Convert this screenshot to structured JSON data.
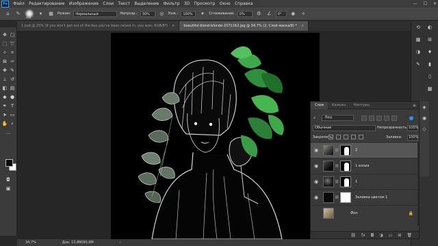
{
  "app": {
    "logo": "Ps"
  },
  "menubar": {
    "items": [
      "Файл",
      "Редактирование",
      "Изображение",
      "Слои",
      "Текст",
      "Выделение",
      "Фильтр",
      "3D",
      "Просмотр",
      "Окно",
      "Справка"
    ],
    "window_controls": {
      "minimize": "—",
      "maximize": "☐",
      "close": "✕"
    }
  },
  "options": {
    "brush_size": "432",
    "mode_label": "Режим:",
    "mode_value": "Нормальный",
    "opacity_label": "Непрозр.:",
    "opacity_value": "30%",
    "flow_label": "Наж.:",
    "flow_value": "100%",
    "smoothing_label": "Сглаживание:",
    "smoothing_value": "0%",
    "angle_value": "0°"
  },
  "tabs": [
    {
      "title": "1.psd @ 25% (If you don't get out of the box you've been raised in, you won, RGB/8*)",
      "close": "×",
      "active": false
    },
    {
      "title": "beautiful-blond-blonde-1071162.jpg @ 34,7% (2, Слой-маска/8) *",
      "close": "×",
      "active": true
    }
  ],
  "statusbar": {
    "zoom": "34,7%",
    "doc_info": "Док: 15,8M/90,9M",
    "arrow": "›"
  },
  "colors": {
    "accent": "#2a90ff",
    "canvas_bg": "#000000",
    "panel_bg": "#3a3a3a",
    "leaf_green": "#3ea84a"
  },
  "layers_panel": {
    "tabs": [
      "Слои",
      "Каналы",
      "Контуры"
    ],
    "menu_icon": "≡",
    "search_value": "Вид",
    "blend_mode": "Обычные",
    "opacity_label": "Непрозрачность:",
    "opacity_value": "100%",
    "lock_label": "Закрепить:",
    "fill_label": "Заливка:",
    "fill_value": "100%",
    "layers": [
      {
        "name": "2",
        "thumb": "photo",
        "mask": "figure",
        "selected": true,
        "visible": true,
        "locked": false
      },
      {
        "name": "1 копия",
        "thumb": "inv",
        "mask": "figure",
        "selected": false,
        "visible": true,
        "locked": false
      },
      {
        "name": "1",
        "thumb": "sketch",
        "mask": "figure",
        "selected": false,
        "visible": true,
        "locked": false
      },
      {
        "name": "Заливка цветом 1",
        "thumb": "fill",
        "mask": "white",
        "selected": false,
        "visible": true,
        "locked": false
      },
      {
        "name": "Фон",
        "thumb": "fon",
        "mask": "none",
        "selected": false,
        "visible": false,
        "locked": true
      }
    ],
    "footer_icons": [
      "link-icon",
      "fx-icon",
      "mask-icon",
      "adjustment-icon",
      "folder-icon",
      "new-layer-icon",
      "trash-icon"
    ]
  }
}
